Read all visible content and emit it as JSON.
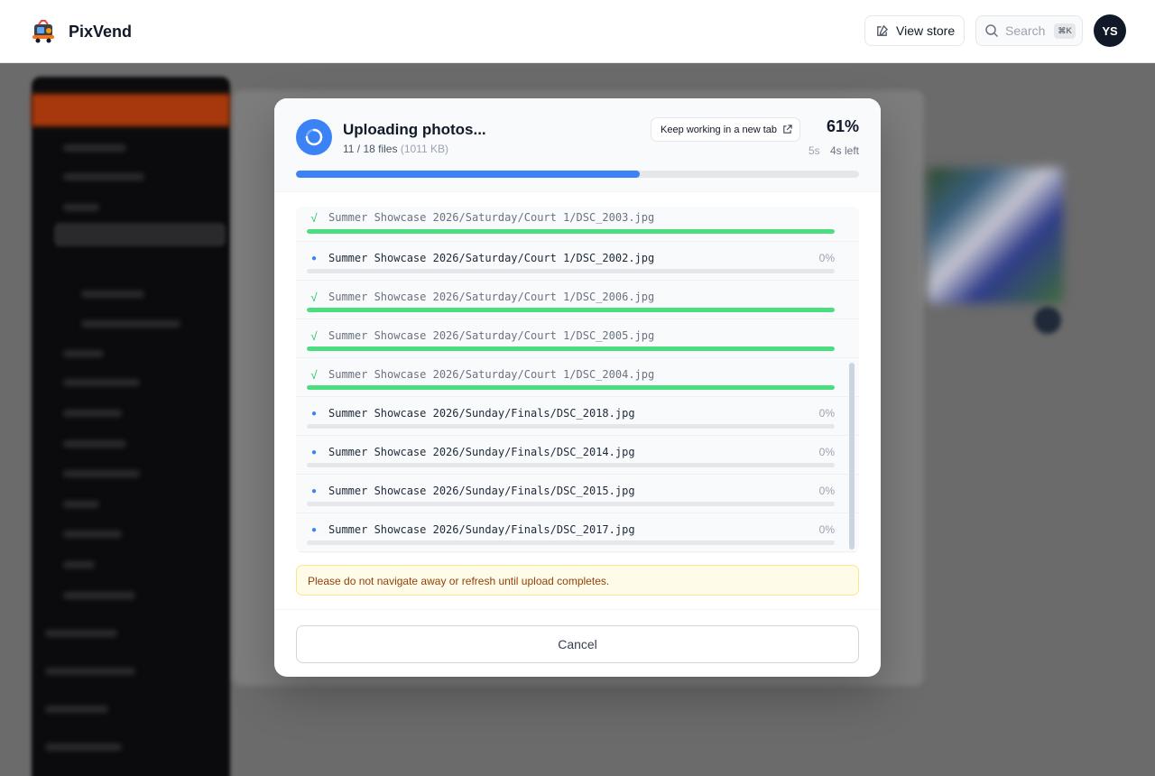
{
  "app": {
    "name": "PixVend"
  },
  "header": {
    "view_store_label": "View store",
    "search_placeholder": "Search",
    "search_shortcut": "⌘K",
    "avatar_initials": "YS"
  },
  "upload": {
    "title": "Uploading photos...",
    "files_count": "11 / 18 files",
    "files_size": "(1011 KB)",
    "keep_working_label": "Keep working in a new tab",
    "percent_label": "61%",
    "progress": 0.61,
    "elapsed": "5s",
    "remaining": "4s left",
    "accent_color": "#3b82f6",
    "done_color": "#4ade80",
    "files": [
      {
        "name": "Summer Showcase 2026/Saturday/Court 1/DSC_2003.jpg",
        "status": "done",
        "progress": 1.0,
        "pct_label": ""
      },
      {
        "name": "Summer Showcase 2026/Saturday/Court 1/DSC_2002.jpg",
        "status": "pending",
        "progress": 0.0,
        "pct_label": "0%"
      },
      {
        "name": "Summer Showcase 2026/Saturday/Court 1/DSC_2006.jpg",
        "status": "done",
        "progress": 1.0,
        "pct_label": ""
      },
      {
        "name": "Summer Showcase 2026/Saturday/Court 1/DSC_2005.jpg",
        "status": "done",
        "progress": 1.0,
        "pct_label": ""
      },
      {
        "name": "Summer Showcase 2026/Saturday/Court 1/DSC_2004.jpg",
        "status": "done",
        "progress": 1.0,
        "pct_label": ""
      },
      {
        "name": "Summer Showcase 2026/Sunday/Finals/DSC_2018.jpg",
        "status": "pending",
        "progress": 0.0,
        "pct_label": "0%"
      },
      {
        "name": "Summer Showcase 2026/Sunday/Finals/DSC_2014.jpg",
        "status": "pending",
        "progress": 0.0,
        "pct_label": "0%"
      },
      {
        "name": "Summer Showcase 2026/Sunday/Finals/DSC_2015.jpg",
        "status": "pending",
        "progress": 0.0,
        "pct_label": "0%"
      },
      {
        "name": "Summer Showcase 2026/Sunday/Finals/DSC_2017.jpg",
        "status": "pending",
        "progress": 0.0,
        "pct_label": "0%"
      }
    ],
    "warning": "Please do not navigate away or refresh until upload completes.",
    "cancel_label": "Cancel"
  }
}
